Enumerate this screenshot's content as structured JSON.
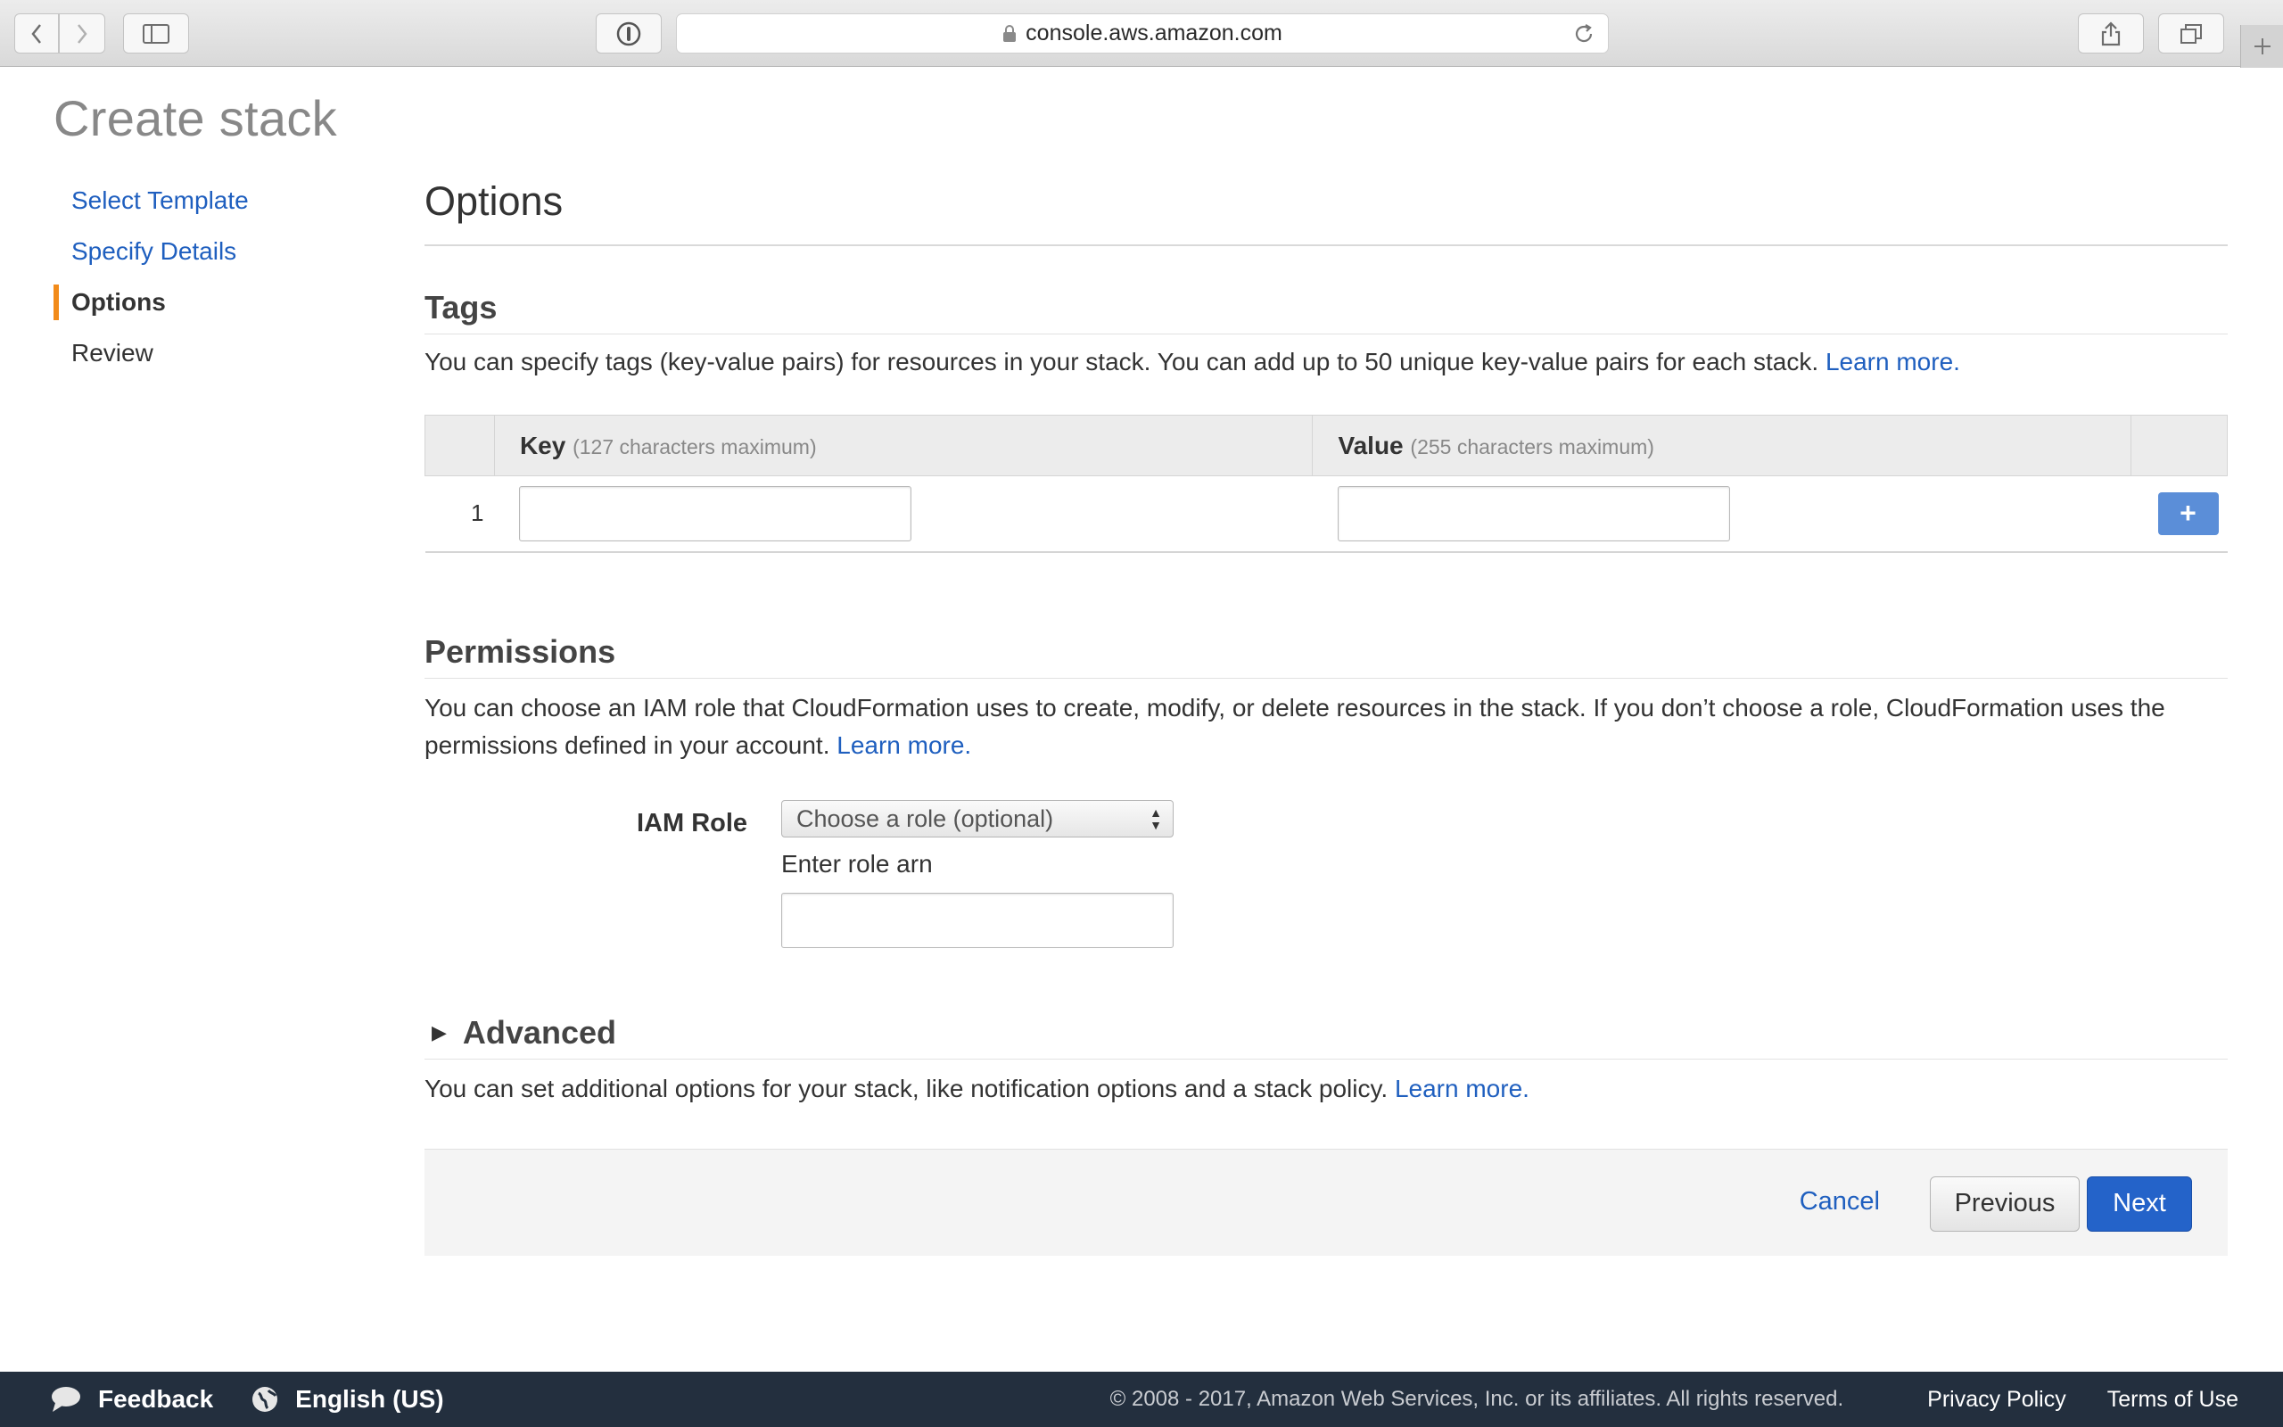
{
  "browser": {
    "url": "console.aws.amazon.com"
  },
  "page": {
    "title": "Create stack"
  },
  "steps": [
    {
      "label": "Select Template"
    },
    {
      "label": "Specify Details"
    },
    {
      "label": "Options"
    },
    {
      "label": "Review"
    }
  ],
  "main": {
    "heading": "Options",
    "tags": {
      "heading": "Tags",
      "description": "You can specify tags (key-value pairs) for resources in your stack. You can add up to 50 unique key-value pairs for each stack.",
      "learn_more": "Learn more.",
      "key_header": "Key",
      "key_hint": "(127 characters maximum)",
      "value_header": "Value",
      "value_hint": "(255 characters maximum)",
      "row_number": "1",
      "add_label": "+"
    },
    "permissions": {
      "heading": "Permissions",
      "description": "You can choose an IAM role that CloudFormation uses to create, modify, or delete resources in the stack. If you don’t choose a role, CloudFormation uses the permissions defined in your account.",
      "learn_more": "Learn more.",
      "iam_role_label": "IAM Role",
      "iam_role_selected": "Choose a role (optional)",
      "arn_label": "Enter role arn"
    },
    "advanced": {
      "heading": "Advanced",
      "description": "You can set additional options for your stack, like notification options and a stack policy.",
      "learn_more": "Learn more."
    },
    "actions": {
      "cancel": "Cancel",
      "previous": "Previous",
      "next": "Next"
    }
  },
  "footer": {
    "feedback": "Feedback",
    "language": "English (US)",
    "copyright": "© 2008 - 2017, Amazon Web Services, Inc. or its affiliates. All rights reserved.",
    "privacy": "Privacy Policy",
    "terms": "Terms of Use"
  },
  "colors": {
    "link": "#1f5fbf",
    "active_step_marker": "#f28b1a",
    "primary_button": "#2463c9",
    "footer_bg": "#232f3e"
  }
}
